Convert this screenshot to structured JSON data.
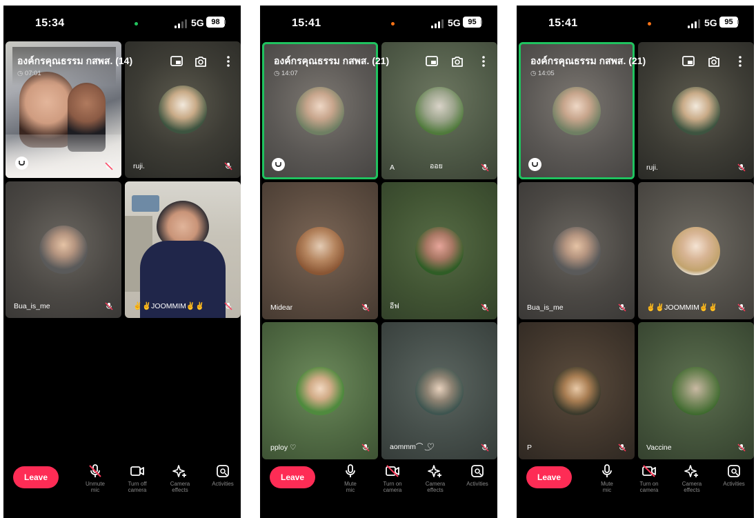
{
  "screens": [
    {
      "status": {
        "time": "15:34",
        "network": "5G",
        "battery": "98",
        "dot_color": "#22c55e"
      },
      "call": {
        "title": "องค์กรคุณธรรม กสพส. (14)",
        "timer": "07:01"
      },
      "tiles": [
        {
          "name": ""
        },
        {
          "name": "ruji."
        },
        {
          "name": "Bua_is_me"
        },
        {
          "name": "✌✌JOOMMIM✌✌"
        }
      ],
      "controls": {
        "leave": "Leave",
        "mic": "Unmute\nmic",
        "camera": "Turn off\ncamera",
        "effects": "Camera\neffects",
        "activities": "Activities"
      }
    },
    {
      "status": {
        "time": "15:41",
        "network": "5G",
        "battery": "95",
        "dot_color": "#f97316"
      },
      "call": {
        "title": "องค์กรคุณธรรม กสพส. (21)",
        "timer": "14:07"
      },
      "tiles": [
        {
          "name": ""
        },
        {
          "name": "A",
          "name2": "ออย"
        },
        {
          "name": "Midear"
        },
        {
          "name": "อีฟ"
        },
        {
          "name": "pploy ♡"
        },
        {
          "name": "aommm⌒ ͜ ♡"
        }
      ],
      "controls": {
        "leave": "Leave",
        "mic": "Mute\nmic",
        "camera": "Turn on\ncamera",
        "effects": "Camera\neffects",
        "activities": "Activities"
      }
    },
    {
      "status": {
        "time": "15:41",
        "network": "5G",
        "battery": "95",
        "dot_color": "#f97316"
      },
      "call": {
        "title": "องค์กรคุณธรรม กสพส. (21)",
        "timer": "14:05"
      },
      "tiles": [
        {
          "name": ""
        },
        {
          "name": "ruji."
        },
        {
          "name": "Bua_is_me"
        },
        {
          "name": "✌✌JOOMMIM✌✌"
        },
        {
          "name": "P"
        },
        {
          "name": "Vaccine"
        }
      ],
      "controls": {
        "leave": "Leave",
        "mic": "Mute\nmic",
        "camera": "Turn on\ncamera",
        "effects": "Camera\neffects",
        "activities": "Activities"
      }
    }
  ],
  "icons": {
    "mic_muted": "mic-muted-icon",
    "mic": "mic-icon",
    "camera": "camera-icon",
    "camera_off": "camera-off-icon",
    "effects": "sparkle-icon",
    "activities": "activities-icon",
    "switch_camera": "switch-camera-icon",
    "picture_in_picture": "picture-in-picture-icon",
    "more": "more-vertical-icon",
    "clock": "clock-icon",
    "smiley": "emoji-reaction-icon"
  },
  "colors": {
    "accent_red": "#fe2c55",
    "active_speaker": "#1fc35f",
    "muted_icon": "#ff3b5c",
    "label_gray": "#8a8a8a"
  }
}
